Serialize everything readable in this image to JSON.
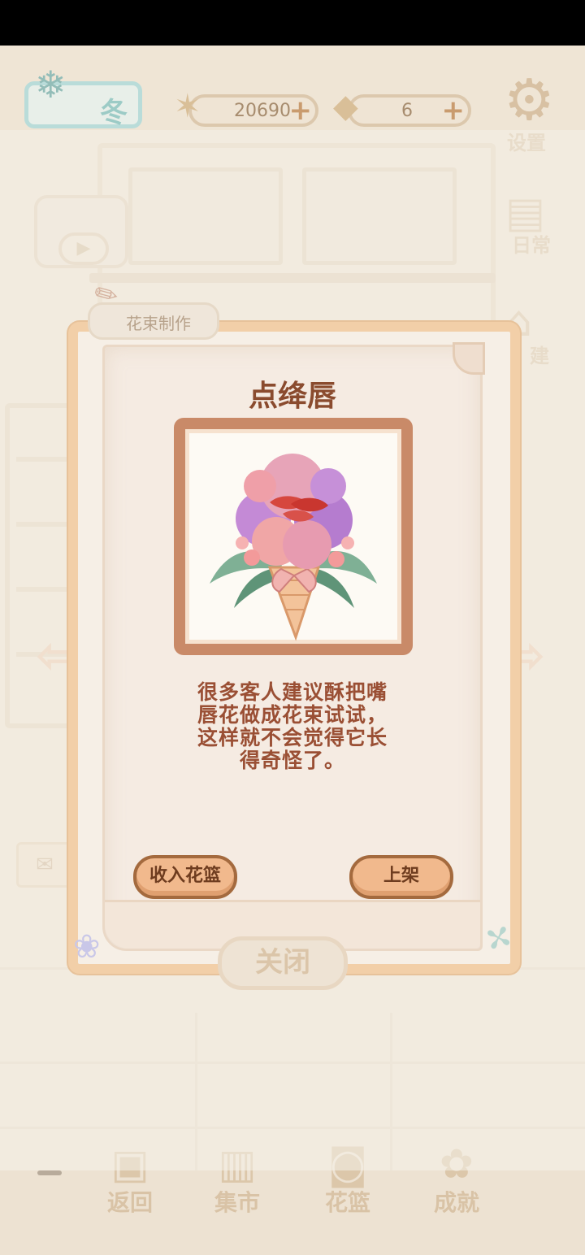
{
  "top_bar": {
    "season_label": "冬",
    "fish_count": "20690",
    "cheese_count": "6",
    "plus_symbol": "+",
    "settings_label": "设置"
  },
  "side_buttons": [
    {
      "label": "日常",
      "icon": "daily-icon"
    },
    {
      "label": "建",
      "icon": "build-icon"
    }
  ],
  "modal": {
    "tab_label": "花束制作",
    "flower_name": "点绛唇",
    "description_lines": [
      "很多客人建议酥把嘴",
      "唇花做成花束试试，",
      "这样就不会觉得它长",
      "得奇怪了。"
    ],
    "left_button_label": "收入花篮",
    "right_button_label": "上架",
    "close_label": "关闭"
  },
  "bottom_nav": [
    {
      "label": "返回",
      "icon": "back-icon"
    },
    {
      "label": "集市",
      "icon": "market-icon"
    },
    {
      "label": "花篮",
      "icon": "basket-icon"
    },
    {
      "label": "成就",
      "icon": "achievement-icon"
    }
  ],
  "colors": {
    "accent_brown": "#8a4b2e",
    "button_fill": "#f1b98d",
    "frame_peach": "#f2cfa8",
    "picture_frame": "#c98a68"
  }
}
